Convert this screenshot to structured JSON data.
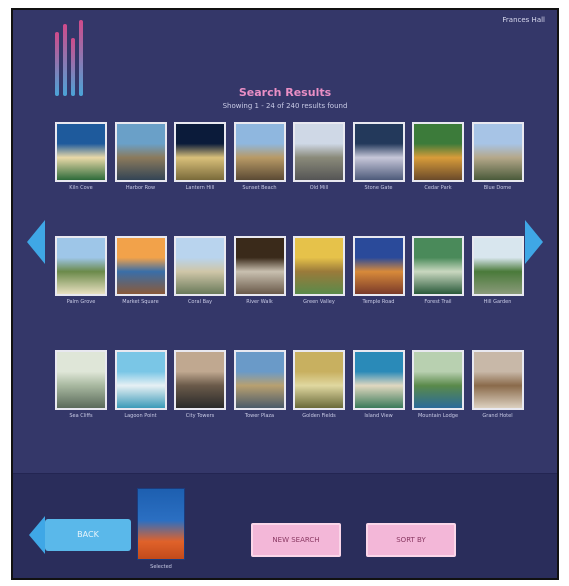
{
  "header": {
    "user_label": "Frances Hall",
    "title": "Search Results",
    "subtitle": "Showing 1 - 24 of 240 results found"
  },
  "icons": {
    "logo": "app-logo",
    "prev": "chevron-left-icon",
    "next": "chevron-right-icon",
    "back": "back-arrow-icon"
  },
  "colors": {
    "background": "#343769",
    "footer": "#2a2d5b",
    "accent_blue": "#3fa7e6",
    "accent_pink": "#f3b7d8",
    "title_pink": "#ea8fc5"
  },
  "results": [
    {
      "label": "Kiln Cove"
    },
    {
      "label": "Harbor Row"
    },
    {
      "label": "Lantern Hill"
    },
    {
      "label": "Sunset Beach"
    },
    {
      "label": "Old Mill"
    },
    {
      "label": "Stone Gate"
    },
    {
      "label": "Cedar Park"
    },
    {
      "label": "Blue Dome"
    },
    {
      "label": "Palm Grove"
    },
    {
      "label": "Market Square"
    },
    {
      "label": "Coral Bay"
    },
    {
      "label": "River Walk"
    },
    {
      "label": "Green Valley"
    },
    {
      "label": "Temple Road"
    },
    {
      "label": "Forest Trail"
    },
    {
      "label": "Hill Garden"
    },
    {
      "label": "Sea Cliffs"
    },
    {
      "label": "Lagoon Point"
    },
    {
      "label": "City Towers"
    },
    {
      "label": "Tower Plaza"
    },
    {
      "label": "Golden Fields"
    },
    {
      "label": "Island View"
    },
    {
      "label": "Mountain Lodge"
    },
    {
      "label": "Grand Hotel"
    }
  ],
  "footer": {
    "back_label": "BACK",
    "preview_caption": "Selected",
    "new_search_label": "NEW SEARCH",
    "sort_label": "SORT BY"
  }
}
